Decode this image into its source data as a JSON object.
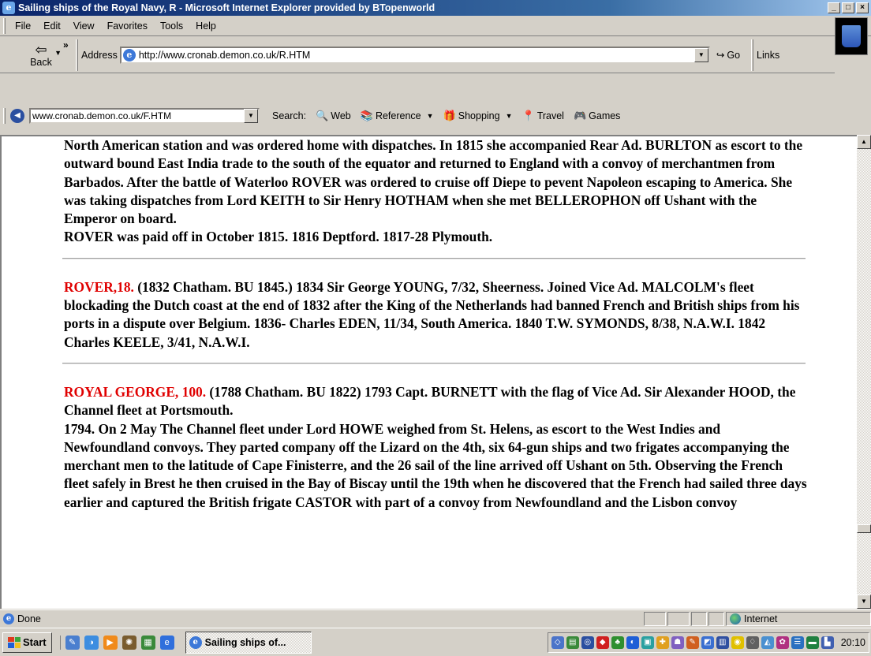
{
  "window": {
    "title": "Sailing ships of the Royal Navy, R - Microsoft Internet Explorer provided by BTopenworld",
    "min": "_",
    "max": "□",
    "close": "×"
  },
  "menu": [
    "File",
    "Edit",
    "View",
    "Favorites",
    "Tools",
    "Help"
  ],
  "toolbar": {
    "back_label": "Back",
    "chevron": "»",
    "address_label": "Address",
    "address_value": "http://www.cronab.demon.co.uk/R.HTM",
    "go_label": "Go",
    "links_label": "Links"
  },
  "search_bar": {
    "combo_value": "www.cronab.demon.co.uk/F.HTM",
    "search_label": "Search:",
    "web": "Web",
    "reference": "Reference",
    "shopping": "Shopping",
    "travel": "Travel",
    "games": "Games"
  },
  "article": {
    "p1": "North American station and was ordered home with dispatches. In 1815 she accompanied Rear Ad. BURLTON as escort to the outward bound East India trade to the south of the equator and returned to England with a convoy of merchantmen from Barbados. After the battle of Waterloo ROVER was ordered to cruise off Diepe to pevent Napoleon escaping to America. She was taking dispatches from Lord KEITH to Sir Henry HOTHAM when she met BELLEROPHON off Ushant with the Emperor on board.",
    "p2": "ROVER was paid off in October 1815. 1816 Deptford. 1817-28 Plymouth.",
    "rover18_name": "ROVER,18.",
    "rover18_text": " (1832 Chatham. BU 1845.) 1834 Sir George YOUNG, 7/32, Sheerness. Joined Vice Ad. MALCOLM's fleet blockading the Dutch coast at the end of 1832 after the King of the Netherlands had banned French and British ships from his ports in a dispute over Belgium. 1836- Charles EDEN, 11/34, South America. 1840 T.W. SYMONDS, 8/38, N.A.W.I. 1842 Charles KEELE, 3/41, N.A.W.I.",
    "rg_name": "ROYAL GEORGE, 100.",
    "rg_text": " (1788 Chatham. BU 1822) 1793 Capt. BURNETT with the flag of Vice Ad. Sir Alexander HOOD, the Channel fleet at Portsmouth.",
    "rg_p2": "1794. On 2 May The Channel fleet under Lord HOWE weighed from St. Helens, as escort to the West Indies and Newfoundland convoys. They parted company off the Lizard on the 4th, six 64-gun ships and two frigates accompanying the merchant men to the latitude of Cape Finisterre, and the 26 sail of the line arrived off Ushant on 5th. Observing the French fleet safely in Brest he then cruised in the Bay of Biscay until the 19th when he discovered that the French had sailed three days earlier and captured the British frigate CASTOR with part of a convoy from Newfoundland and the Lisbon convoy"
  },
  "status": {
    "text": "Done",
    "zone": "Internet"
  },
  "taskbar": {
    "start": "Start",
    "task": "Sailing ships of...",
    "clock": "20:10"
  },
  "colors": {
    "ship_name": "#e00000",
    "titlebar": "#0a246a"
  }
}
